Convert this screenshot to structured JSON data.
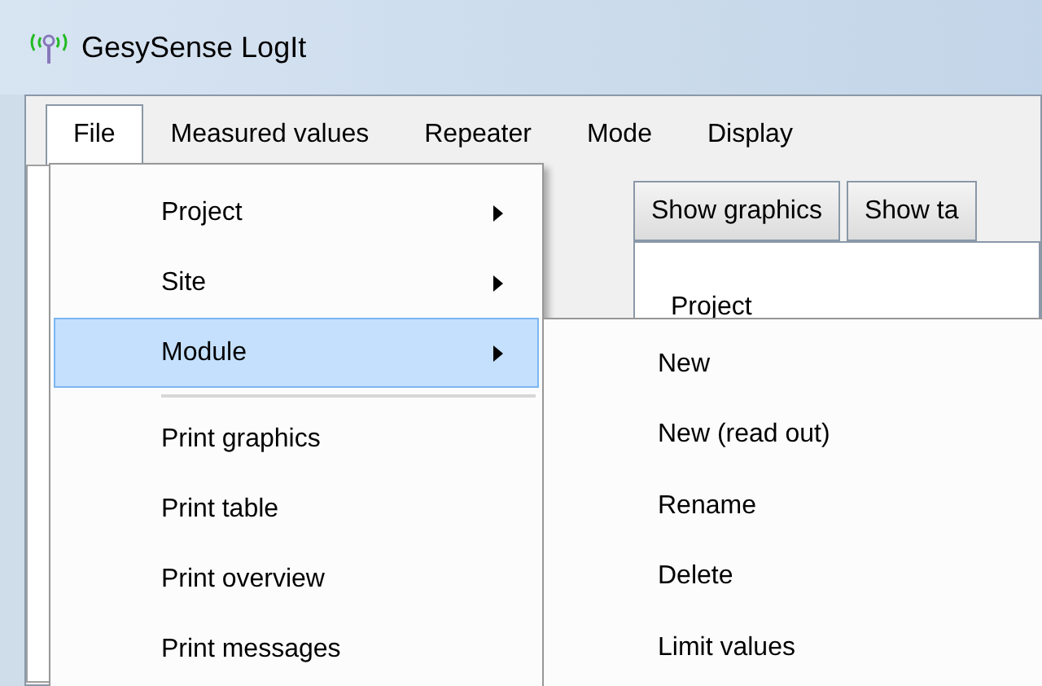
{
  "window": {
    "title": "GesySense LogIt"
  },
  "menu_bar": [
    {
      "label": "File",
      "selected": true
    },
    {
      "label": "Measured values",
      "selected": false
    },
    {
      "label": "Repeater",
      "selected": false
    },
    {
      "label": "Mode",
      "selected": false
    },
    {
      "label": "Display",
      "selected": false
    }
  ],
  "tabs": [
    {
      "label": "Show graphics"
    },
    {
      "label": "Show ta"
    }
  ],
  "panel": {
    "heading": "Project"
  },
  "file_menu": [
    {
      "label": "Project",
      "submenu": true,
      "selected": false
    },
    {
      "label": "Site",
      "submenu": true,
      "selected": false
    },
    {
      "label": "Module",
      "submenu": true,
      "selected": true
    },
    {
      "kind": "separator"
    },
    {
      "label": "Print graphics",
      "submenu": false,
      "selected": false
    },
    {
      "label": "Print table",
      "submenu": false,
      "selected": false
    },
    {
      "label": "Print overview",
      "submenu": false,
      "selected": false
    },
    {
      "label": "Print messages",
      "submenu": false,
      "selected": false
    }
  ],
  "module_submenu": [
    {
      "label": "New"
    },
    {
      "label": "New (read out)"
    },
    {
      "label": "Rename"
    },
    {
      "label": "Delete"
    },
    {
      "label": "Limit values"
    }
  ]
}
